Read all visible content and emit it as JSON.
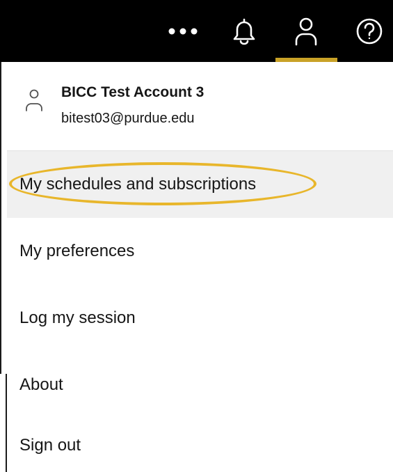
{
  "top_bar": {
    "icons": [
      "more-icon",
      "notifications-icon",
      "user-icon",
      "help-icon"
    ]
  },
  "account": {
    "name": "BICC Test Account 3",
    "email": "bitest03@purdue.edu"
  },
  "menu": {
    "items": [
      {
        "label": "My schedules and subscriptions"
      },
      {
        "label": "My preferences"
      },
      {
        "label": "Log my session"
      },
      {
        "label": "About"
      },
      {
        "label": "Sign out"
      }
    ]
  },
  "colors": {
    "top_bar": "#000000",
    "active_underline": "#c9a227",
    "callout": "#e8b62b",
    "highlight_bg": "#f0f0f0",
    "text": "#161616"
  }
}
